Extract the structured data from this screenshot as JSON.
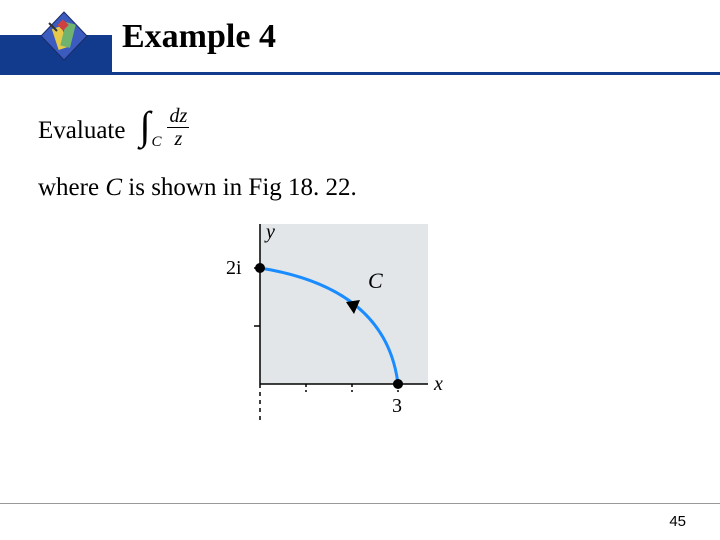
{
  "header": {
    "title": "Example 4"
  },
  "body": {
    "evaluate_label": "Evaluate",
    "integral": {
      "sign": "∫",
      "subscript": "C",
      "numerator": "dz",
      "denominator": "z"
    },
    "where_prefix": "where ",
    "where_C": "C",
    "where_suffix": " is shown in Fig 18. 22."
  },
  "figure": {
    "y_label": "y",
    "x_label": "x",
    "y_tick": "2i",
    "x_tick": "3",
    "curve_label": "C"
  },
  "footer": {
    "page": "45"
  }
}
